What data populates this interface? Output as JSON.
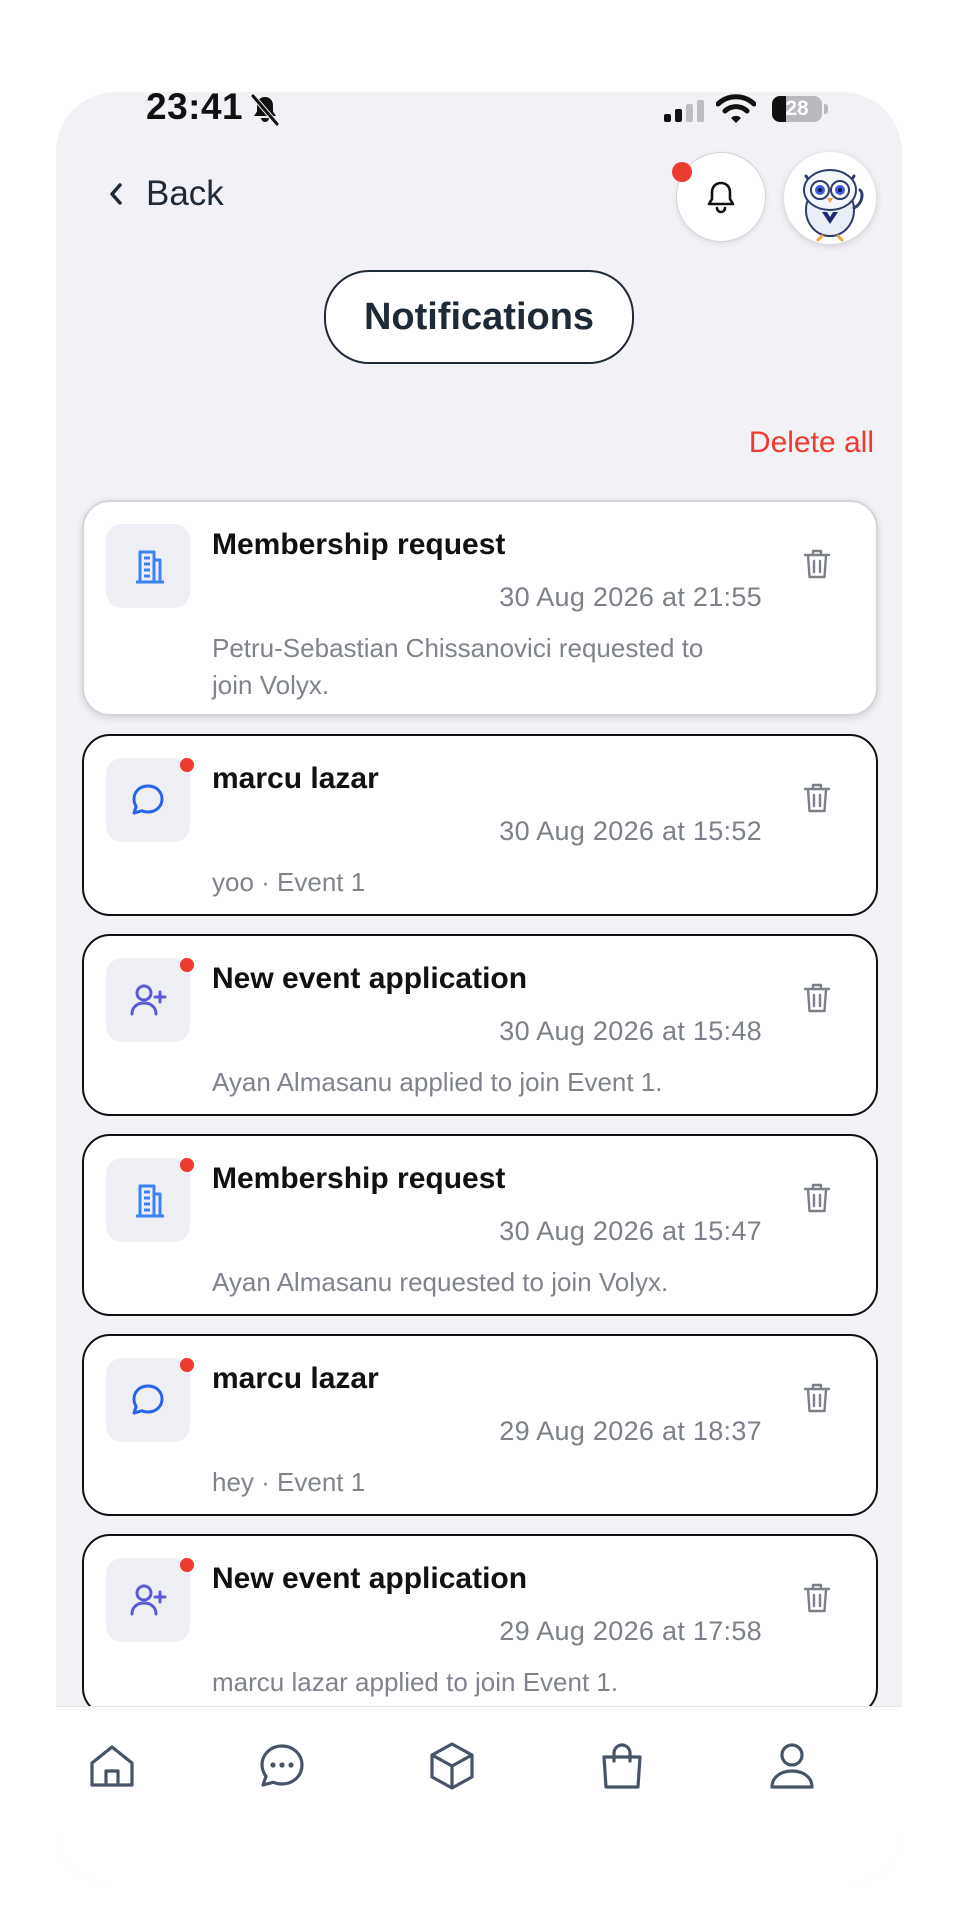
{
  "status_bar": {
    "time": "23:41",
    "battery": "28",
    "battery_level": 0.28
  },
  "header": {
    "back_label": "Back",
    "bell_has_unread": true
  },
  "page_title": "Notifications",
  "delete_all_label": "Delete all",
  "notifications": [
    {
      "type": "membership",
      "icon": "building-icon",
      "unread": false,
      "title": "Membership request",
      "date": "30 Aug 2026 at 21:55",
      "body": "Petru-Sebastian Chissanovici requested to join Volyx."
    },
    {
      "type": "message",
      "icon": "chat-bubble-icon",
      "unread": true,
      "title": "marcu lazar",
      "date": "30 Aug 2026 at 15:52",
      "body": "yoo · Event 1"
    },
    {
      "type": "application",
      "icon": "user-plus-icon",
      "unread": true,
      "title": "New event application",
      "date": "30 Aug 2026 at 15:48",
      "body": "Ayan Almasanu applied to join Event 1."
    },
    {
      "type": "membership",
      "icon": "building-icon",
      "unread": true,
      "title": "Membership request",
      "date": "30 Aug 2026 at 15:47",
      "body": "Ayan Almasanu requested to join Volyx."
    },
    {
      "type": "message",
      "icon": "chat-bubble-icon",
      "unread": true,
      "title": "marcu lazar",
      "date": "29 Aug 2026 at 18:37",
      "body": "hey · Event 1"
    },
    {
      "type": "application",
      "icon": "user-plus-icon",
      "unread": true,
      "title": "New event application",
      "date": "29 Aug 2026 at 17:58",
      "body": "marcu lazar applied to join Event 1."
    }
  ],
  "tab_bar": [
    {
      "name": "home",
      "icon": "home-icon"
    },
    {
      "name": "messages",
      "icon": "chat-dots-icon"
    },
    {
      "name": "events",
      "icon": "cube-icon"
    },
    {
      "name": "shop",
      "icon": "shopping-bag-icon"
    },
    {
      "name": "profile",
      "icon": "user-icon"
    }
  ],
  "colors": {
    "accent_red": "#ee3a2f",
    "dark": "#1f2a37",
    "background": "#f1f1f6",
    "building_blue": "#3b82f6",
    "chat_blue": "#2563eb",
    "user_plus_purple": "#5b5bd6"
  }
}
